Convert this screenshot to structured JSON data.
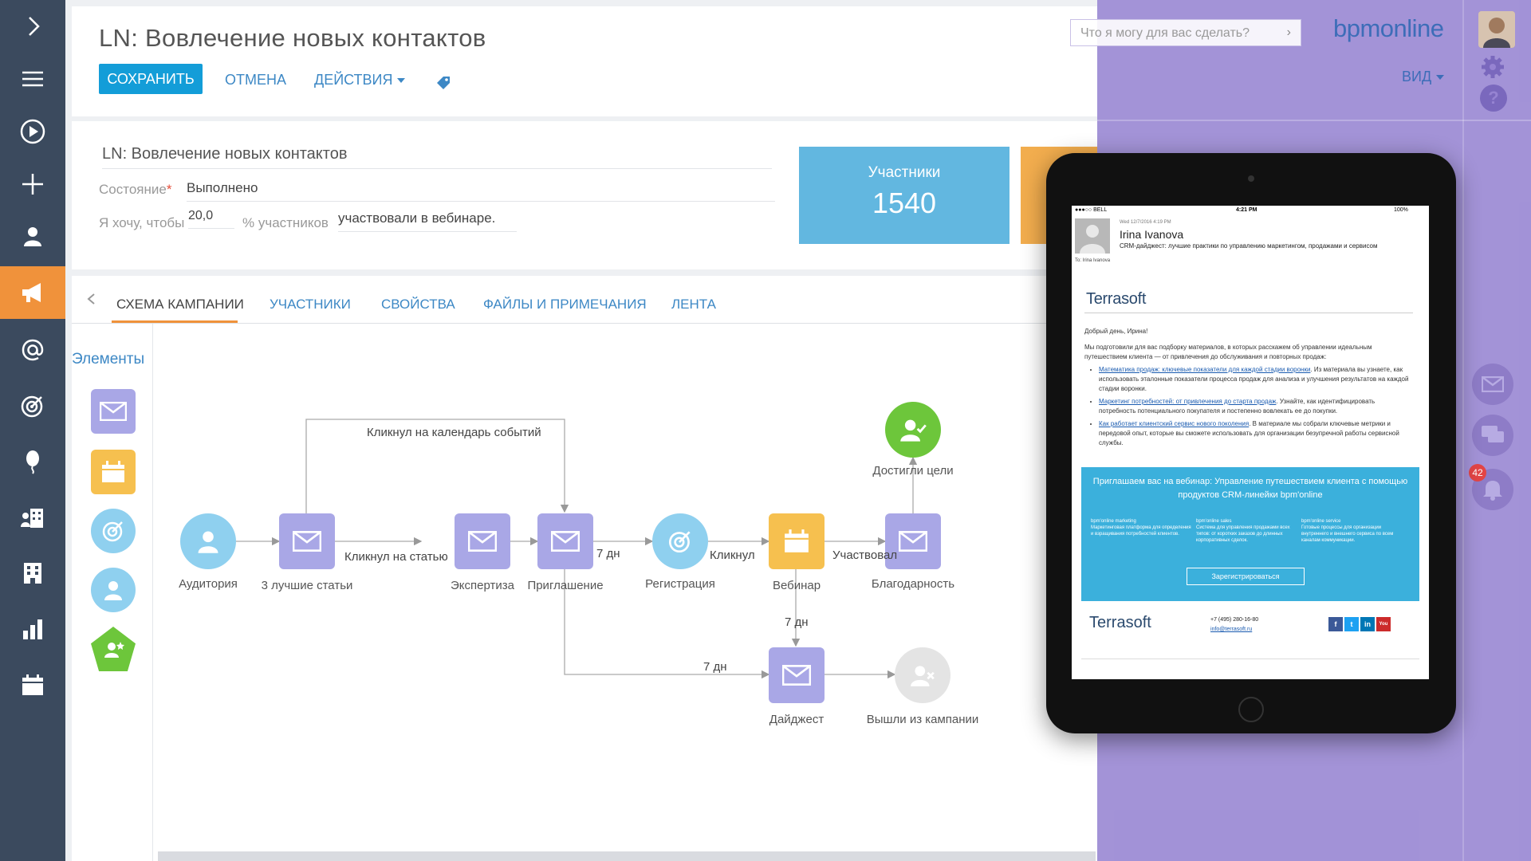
{
  "app": {
    "page_title": "LN: Вовлечение новых контактов"
  },
  "toolbar": {
    "save_label": "СОХРАНИТЬ",
    "cancel_label": "ОТМЕНА",
    "actions_label": "ДЕЙСТВИЯ"
  },
  "form": {
    "name_value": "LN: Вовлечение новых контактов",
    "state_label": "Состояние",
    "state_required_mark": "*",
    "state_value": "Выполнено",
    "goal_label_pre": "Я хочу, чтобы",
    "goal_percent_value": "20,0",
    "goal_label_mid": "% участников",
    "goal_value": "участвовали в вебинаре."
  },
  "stats": {
    "participants_label": "Участники",
    "participants_value": "1540"
  },
  "tabs": [
    "СХЕМА КАМПАНИИ",
    "УЧАСТНИКИ",
    "СВОЙСТВА",
    "ФАЙЛЫ И ПРИМЕЧАНИЯ",
    "ЛЕНТА"
  ],
  "palette": {
    "title": "Элементы"
  },
  "diagram": {
    "nodes": {
      "audience": "Аудитория",
      "best_articles": "3 лучшие статьи",
      "expertise": "Экспертиза",
      "invitation": "Приглашение",
      "registration": "Регистрация",
      "webinar": "Вебинар",
      "thanks": "Благодарность",
      "goal": "Достигли цели",
      "digest": "Дайджест",
      "left": "Вышли из кампании"
    },
    "edges": {
      "clicked_calendar": "Кликнул на календарь событий",
      "clicked_article": "Кликнул на статью",
      "seven_days_1": "7 дн",
      "clicked": "Кликнул",
      "participated": "Участвовал",
      "seven_days_2": "7 дн",
      "seven_days_3": "7 дн"
    }
  },
  "overlay": {
    "search_placeholder": "Что я могу для вас сделать?",
    "brand": "bpmonline",
    "view_label": "ВИД",
    "notifications_count": "42"
  },
  "tablet": {
    "status_carrier": "●●●○○ BELL",
    "status_time": "4:21 PM",
    "status_battery": "100%",
    "mail_date": "Wed 12/7/2016 4:19 PM",
    "sender": "Irina Ivanova",
    "subject": "CRM-дайджест: лучшие практики по управлению маркетингом, продажами и сервисом",
    "to": "To: Irina Ivanova",
    "logo": "Terrasoft",
    "greeting": "Добрый день, Ирина!",
    "intro": "Мы подготовили для вас подборку материалов, в которых расскажем об управлении идеальным путешествием клиента — от привлечения до обслуживания и повторных продаж:",
    "bullets": [
      {
        "link": "Математика продаж: ключевые показатели для каждой стадии воронки",
        "text": ". Из материала вы узнаете, как использовать эталонные показатели процесса продаж для анализа и улучшения результатов на каждой стадии воронки."
      },
      {
        "link": "Маркетинг потребностей: от привлечения до старта продаж",
        "text": ". Узнайте, как идентифицировать потребность потенциального покупателя и постепенно вовлекать ее до покупки."
      },
      {
        "link": "Как работает клиентский сервис нового поколения",
        "text": ". В материале мы собрали ключевые метрики и передовой опыт, которые вы сможете использовать для организации безупречной работы сервисной службы."
      }
    ],
    "promo_title": "Приглашаем вас на вебинар: Управление путешествием клиента с помощью продуктов CRM-линейки bpm'online",
    "promo_cols": [
      {
        "title": "bpm'online marketing",
        "text": "Маркетинговая платформа для определения и взращивания потребностей клиентов."
      },
      {
        "title": "bpm'online sales",
        "text": "Система для управления продажами всех типов: от коротких заказов до длинных корпоративных сделок."
      },
      {
        "title": "bpm'online service",
        "text": "Готовые процессы для организации внутреннего и внешнего сервиса по всем каналам коммуникации."
      }
    ],
    "promo_button": "Зарегистрироваться",
    "footer_logo": "Terrasoft",
    "phone": "+7 (495) 280-16-80",
    "email": "info@terrasoft.ru",
    "social": [
      "f",
      "t",
      "in",
      "You"
    ]
  },
  "colors": {
    "sidebar": "#3b4a5e",
    "accent_orange": "#f0923b",
    "primary_blue": "#139dd8",
    "email_node": "#a9a7e6",
    "calendar_node": "#f6c04f",
    "audience_node": "#8fd0ef",
    "goal_node": "#6dc63b",
    "overlay": "#9683d2",
    "promo_blue": "#3bb0dc"
  }
}
